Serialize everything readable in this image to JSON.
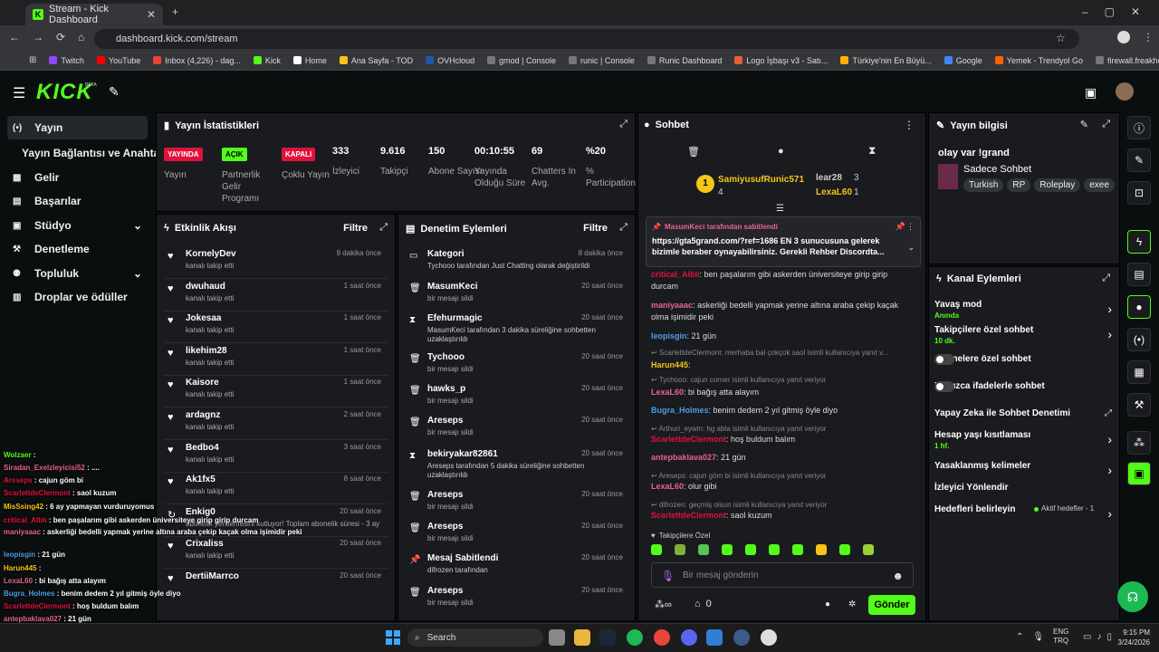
{
  "browser": {
    "tab_title": "Stream - Kick Dashboard",
    "url": "dashboard.kick.com/stream",
    "bookmarks": [
      "Twitch",
      "YouTube",
      "Inbox (4,226) - dag...",
      "Kick",
      "Home",
      "Ana Sayfa - TOD",
      "OVHcloud",
      "gmod | Console",
      "runic | Console",
      "Runic Dashboard",
      "Logo İşbaşı v3 - Satı...",
      "Türkiye'nin En Büyü...",
      "Google",
      "Yemek - Trendyol Go",
      "firewall.freakhosting..."
    ]
  },
  "app": {
    "logo": "KICK",
    "beta": "BETA"
  },
  "sidebar": {
    "items": [
      {
        "label": "Yayın",
        "icon": "broadcast-icon"
      },
      {
        "label": "Yayın Bağlantısı ve Anahtarı"
      },
      {
        "label": "Gelir",
        "icon": "money-icon"
      },
      {
        "label": "Başarılar",
        "icon": "trophy-icon"
      },
      {
        "label": "Stüdyo",
        "icon": "studio-icon"
      },
      {
        "label": "Denetleme",
        "icon": "wrench-icon"
      },
      {
        "label": "Topluluk",
        "icon": "community-icon"
      },
      {
        "label": "Droplar ve ödüller",
        "icon": "gift-icon"
      }
    ]
  },
  "stats": {
    "title": "Yayın İstatistikleri",
    "badges": [
      {
        "label": "YAYINDA",
        "sub": "Yayın"
      },
      {
        "label": "AÇIK",
        "sub": "Partnerlik Gelir Programı"
      },
      {
        "label": "KAPALI",
        "sub": "Çoklu Yayın"
      }
    ],
    "metrics": [
      {
        "value": "333",
        "label": "İzleyici"
      },
      {
        "value": "9.616",
        "label": "Takipçi"
      },
      {
        "value": "150",
        "label": "Abone Sayısı"
      },
      {
        "value": "00:10:55",
        "label": "Yayında Olduğu Süre"
      },
      {
        "value": "69",
        "label": "Chatters In Avg."
      },
      {
        "value": "%20",
        "label": "% Participation"
      }
    ]
  },
  "activity": {
    "title": "Etkinlik Akışı",
    "filter": "Filtre",
    "items": [
      {
        "name": "KornelyDev",
        "sub": "kanalı takip etti",
        "time": "9 dakika önce"
      },
      {
        "name": "dwuhaud",
        "sub": "kanalı takip etti",
        "time": "1 saat önce"
      },
      {
        "name": "Jokesaa",
        "sub": "kanalı takip etti",
        "time": "1 saat önce"
      },
      {
        "name": "likehim28",
        "sub": "kanalı takip etti",
        "time": "1 saat önce"
      },
      {
        "name": "Kaisore",
        "sub": "kanalı takip etti",
        "time": "1 saat önce"
      },
      {
        "name": "ardagnz",
        "sub": "kanalı takip etti",
        "time": "2 saat önce"
      },
      {
        "name": "Bedbo4",
        "sub": "kanalı takip etti",
        "time": "3 saat önce"
      },
      {
        "name": "Ak1fx5",
        "sub": "kanalı takip etti",
        "time": "8 saat önce"
      },
      {
        "name": "Enkig0",
        "sub": "abonelik yenilemesini kutluyor! Toplam abonelik süresi - 3 ay",
        "time": "20 saat önce"
      },
      {
        "name": "Crixaliss",
        "sub": "kanalı takip etti",
        "time": "20 saat önce"
      },
      {
        "name": "DertiiMarrco",
        "sub": "",
        "time": "20 saat önce"
      }
    ]
  },
  "mod": {
    "title": "Denetim Eylemleri",
    "filter": "Filtre",
    "items": [
      {
        "name": "Kategori",
        "sub": "Tychooo tarafından Just Chatting olarak değiştirildi",
        "time": "8 dakika önce"
      },
      {
        "name": "MasumKeci",
        "sub": "bir mesajı sildi",
        "time": "20 saat önce"
      },
      {
        "name": "Efehurmagic",
        "sub": "MasumKeci tarafından 3 dakika süreliğine sohbetten uzaklaştırıldı",
        "time": "20 saat önce"
      },
      {
        "name": "Tychooo",
        "sub": "bir mesajı sildi",
        "time": "20 saat önce"
      },
      {
        "name": "hawks_p",
        "sub": "bir mesajı sildi",
        "time": "20 saat önce"
      },
      {
        "name": "Areseps",
        "sub": "bir mesajı sildi",
        "time": "20 saat önce"
      },
      {
        "name": "bekiryakar82861",
        "sub": "Areseps tarafından 5 dakika süreliğine sohbetten uzaklaştırıldı",
        "time": "20 saat önce"
      },
      {
        "name": "Areseps",
        "sub": "bir mesajı sildi",
        "time": "20 saat önce"
      },
      {
        "name": "Areseps",
        "sub": "bir mesajı sildi",
        "time": "20 saat önce"
      },
      {
        "name": "Mesaj Sabitlendi",
        "sub": "difrozen tarafından",
        "time": "20 saat önce"
      },
      {
        "name": "Areseps",
        "sub": "bir mesajı sildi",
        "time": "20 saat önce"
      }
    ]
  },
  "chat": {
    "title": "Sohbet",
    "top": [
      {
        "name": "SamiyusufRunic571",
        "count": "4"
      },
      {
        "name": "lear28",
        "count": "3"
      },
      {
        "name": "LexaL60",
        "count": "1"
      }
    ],
    "pinned_by": "MasumKeci tarafından sabitlendi",
    "pinned_text": "https://gta5grand.com/?ref=1686 EN 3 sunucusuna gelerek bizimle beraber oynayabilirsiniz. Gerekli Rehber Discordta...",
    "lines": [
      {
        "user": "critical_Alblı",
        "text": "ben paşalarım gibi askerden üniversiteye girip girip durcam"
      },
      {
        "user": "maniyaaac",
        "text": "askerliği bedelli yapmak yerine altına araba çekip kaçak olma işimidir peki"
      },
      {
        "user": "leopisgin",
        "text": "21 gün"
      },
      {
        "reply": "ScarlettdeClermont: merhaba bal çokçok saol isimli kullanıcıya yanıt v..."
      },
      {
        "user": "Harun445",
        "text": ""
      },
      {
        "reply": "Tychooo: cajun corner isimli kullanıcıya yanıt veriyor"
      },
      {
        "user": "LexaL60",
        "text": "bi bağış atta alayım"
      },
      {
        "user": "Bugra_Holmes",
        "text": "benim dedem 2 yıl gitmiş öyle diyo"
      },
      {
        "reply": "Arthuri_eywin: hg abla isimli kullanıcıya yanıt veriyor"
      },
      {
        "user": "ScarlettdeClermont",
        "text": "hoş buldum balım"
      },
      {
        "user": "antepbaklava027",
        "text": "21 gün"
      },
      {
        "reply": "Areseps: cajun göm bi isimli kullanıcıya yanıt veriyor"
      },
      {
        "user": "LexaL60",
        "text": "olur gibi"
      },
      {
        "reply": "difrozen: geçmiş olsun isimli kullanıcıya yanıt veriyor"
      },
      {
        "user": "ScarlettdeClermont",
        "text": "saol kuzum"
      }
    ],
    "follow_only": "Takipçilere Özel",
    "placeholder": "Bir mesaj gönderin",
    "count": "0",
    "send": "Gönder"
  },
  "info": {
    "title": "Yayın bilgisi",
    "stream_title": "olay var !grand",
    "category": "Sadece Sohbet",
    "tags": [
      "Turkish",
      "RP",
      "Roleplay",
      "exee"
    ]
  },
  "actions": {
    "title": "Kanal Eylemleri",
    "items": [
      {
        "label": "Yavaş mod",
        "sub": "Anında",
        "kind": "chev"
      },
      {
        "label": "Takipçilere özel sohbet",
        "sub": "10 dk.",
        "kind": "chev"
      },
      {
        "label": "Abonelere özel sohbet",
        "sub": "",
        "kind": "toggle"
      },
      {
        "label": "Yalnızca ifadelerle sohbet",
        "sub": "",
        "kind": "toggle"
      },
      {
        "label": "Yapay Zeka ile Sohbet Denetimi",
        "sub": "",
        "kind": "ext"
      },
      {
        "label": "Hesap yaşı kısıtlaması",
        "sub": "1 hf.",
        "kind": "chev"
      },
      {
        "label": "Yasaklanmış kelimeler",
        "sub": "",
        "kind": "chev"
      },
      {
        "label": "İzleyici Yönlendir",
        "sub": "",
        "kind": "none"
      },
      {
        "label": "Hedefleri belirleyin",
        "sub": "",
        "extra": "Aktif hedefler - 1",
        "kind": "chev"
      }
    ]
  },
  "overlay": [
    {
      "u": "Wolzaer",
      "t": ""
    },
    {
      "u": "Siradan_Exelzleyicisi52",
      "t": "...."
    },
    {
      "u": "Areseps",
      "t": "cajun göm bi"
    },
    {
      "u": "ScarlettdeClermont",
      "t": "saol kuzum"
    },
    {
      "u": "MisSsing42",
      "t": "6 ay yapmayan vurduruyomus"
    },
    {
      "u": "critical_Alblı",
      "t": "ben paşalarım gibi askerden üniversiteye girip girip durcam"
    },
    {
      "u": "maniyaaac",
      "t": "askerliği bedelli yapmak yerine altına araba çekip kaçak olma işimidir peki"
    },
    {
      "u": "leopisgin",
      "t": "21 gün"
    },
    {
      "u": "Harun445",
      "t": ""
    },
    {
      "u": "LexaL60",
      "t": "bi bağış atta alayım"
    },
    {
      "u": "Bugra_Holmes",
      "t": "benim dedem 2 yıl gitmiş öyle diyo"
    },
    {
      "u": "ScarlettdeClermont",
      "t": "hoş buldum balım"
    },
    {
      "u": "antepbaklava027",
      "t": "21 gün"
    },
    {
      "u": "LexaL60",
      "t": "olur gibi"
    },
    {
      "u": "ScarlettdeClermont",
      "t": "saol kuzum"
    }
  ],
  "taskbar": {
    "search": "Search",
    "lang1": "ENG",
    "lang2": "TRQ",
    "time": "9:15 PM",
    "date": "3/24/2026"
  }
}
